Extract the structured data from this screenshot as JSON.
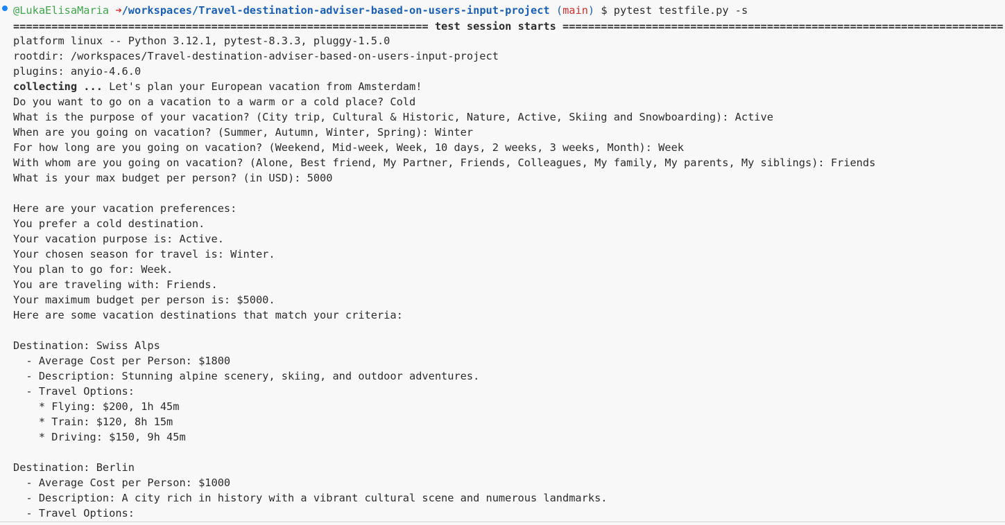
{
  "prompt": {
    "user": "@LukaElisaMaria",
    "arrow": "➜",
    "path": "/workspaces/Travel-destination-adviser-based-on-users-input-project",
    "branch_open": "(",
    "branch": "main",
    "branch_close": ")",
    "command": "$ pytest testfile.py -s"
  },
  "session_header": {
    "left_rule": "=================================================================",
    "title": "test session starts",
    "right_rule": "====================================================================="
  },
  "info": {
    "platform": "platform linux -- Python 3.12.1, pytest-8.3.3, pluggy-1.5.0",
    "rootdir": "rootdir: /workspaces/Travel-destination-adviser-based-on-users-input-project",
    "plugins": "plugins: anyio-4.6.0"
  },
  "collecting": {
    "label": "collecting ...",
    "text": " Let's plan your European vacation from Amsterdam!"
  },
  "questions": [
    "Do you want to go on a vacation to a warm or a cold place? Cold",
    "What is the purpose of your vacation? (City trip, Cultural & Historic, Nature, Active, Skiing and Snowboarding): Active",
    "When are you going on vacation? (Summer, Autumn, Winter, Spring): Winter",
    "For how long are you going on vacation? (Weekend, Mid-week, Week, 10 days, 2 weeks, 3 weeks, Month): Week",
    "With whom are you going on vacation? (Alone, Best friend, My Partner, Friends, Colleagues, My family, My parents, My siblings): Friends",
    "What is your max budget per person? (in USD): 5000"
  ],
  "preferences": [
    "Here are your vacation preferences:",
    "You prefer a cold destination.",
    "Your vacation purpose is: Active.",
    "Your chosen season for travel is: Winter.",
    "You plan to go for: Week.",
    "You are traveling with: Friends.",
    "Your maximum budget per person is: $5000.",
    "Here are some vacation destinations that match your criteria:"
  ],
  "destination1": [
    "Destination: Swiss Alps",
    "  - Average Cost per Person: $1800",
    "  - Description: Stunning alpine scenery, skiing, and outdoor adventures.",
    "  - Travel Options:",
    "    * Flying: $200, 1h 45m",
    "    * Train: $120, 8h 15m",
    "    * Driving: $150, 9h 45m"
  ],
  "destination2": [
    "Destination: Berlin",
    "  - Average Cost per Person: $1000",
    "  - Description: A city rich in history with a vibrant cultural scene and numerous landmarks.",
    "  - Travel Options:"
  ]
}
